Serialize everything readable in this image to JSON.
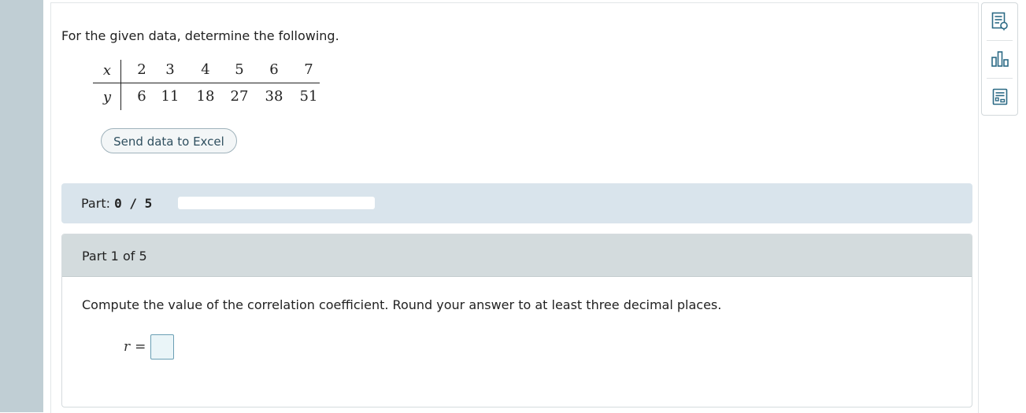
{
  "problem": {
    "prompt": "For the given data, determine the following.",
    "table": {
      "x_label": "x",
      "y_label": "y",
      "x_values": [
        "2",
        "3",
        "4",
        "5",
        "6",
        "7"
      ],
      "y_values": [
        "6",
        "11",
        "18",
        "27",
        "38",
        "51"
      ]
    },
    "excel_button": "Send data to Excel"
  },
  "progress": {
    "label": "Part:",
    "value": "0 / 5",
    "fraction": 0
  },
  "part": {
    "header": "Part 1 of 5",
    "question": "Compute the value of the correlation coefficient. Round your answer to at least three decimal places.",
    "answer_label": "r",
    "equals": "=",
    "answer_value": ""
  },
  "toolbar": {
    "icons": [
      "explanation-icon",
      "data-chart-icon",
      "calculator-icon"
    ]
  },
  "colors": {
    "rail": "#c0ced4",
    "progress_bar_bg": "#d9e4ec",
    "part_header_bg": "#d3dbdd",
    "accent": "#4d8ea6"
  }
}
